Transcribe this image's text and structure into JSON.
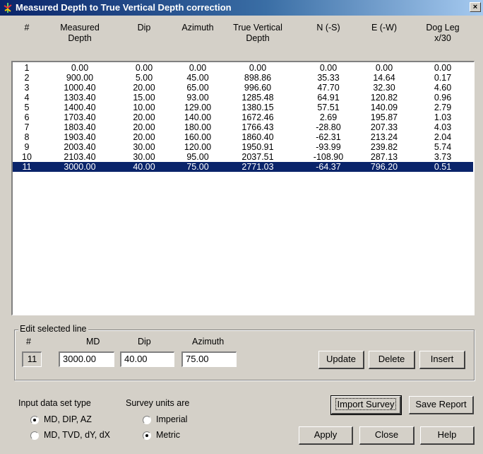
{
  "window": {
    "title": "Measured Depth to True Vertical Depth correction",
    "close_glyph": "×"
  },
  "columns": [
    {
      "key": "n",
      "label": "#"
    },
    {
      "key": "md",
      "label": "Measured\nDepth"
    },
    {
      "key": "dip",
      "label": "Dip"
    },
    {
      "key": "az",
      "label": "Azimuth"
    },
    {
      "key": "tvd",
      "label": "True Vertical\nDepth"
    },
    {
      "key": "ns",
      "label": "N (-S)"
    },
    {
      "key": "ew",
      "label": "E (-W)"
    },
    {
      "key": "dl",
      "label": "Dog Leg\nx/30"
    }
  ],
  "rows": [
    [
      "1",
      "0.00",
      "0.00",
      "0.00",
      "0.00",
      "0.00",
      "0.00",
      "0.00"
    ],
    [
      "2",
      "900.00",
      "5.00",
      "45.00",
      "898.86",
      "35.33",
      "14.64",
      "0.17"
    ],
    [
      "3",
      "1000.40",
      "20.00",
      "65.00",
      "996.60",
      "47.70",
      "32.30",
      "4.60"
    ],
    [
      "4",
      "1303.40",
      "15.00",
      "93.00",
      "1285.48",
      "64.91",
      "120.82",
      "0.96"
    ],
    [
      "5",
      "1400.40",
      "10.00",
      "129.00",
      "1380.15",
      "57.51",
      "140.09",
      "2.79"
    ],
    [
      "6",
      "1703.40",
      "20.00",
      "140.00",
      "1672.46",
      "2.69",
      "195.87",
      "1.03"
    ],
    [
      "7",
      "1803.40",
      "20.00",
      "180.00",
      "1766.43",
      "-28.80",
      "207.33",
      "4.03"
    ],
    [
      "8",
      "1903.40",
      "20.00",
      "160.00",
      "1860.40",
      "-62.31",
      "213.24",
      "2.04"
    ],
    [
      "9",
      "2003.40",
      "30.00",
      "120.00",
      "1950.91",
      "-93.99",
      "239.82",
      "5.74"
    ],
    [
      "10",
      "2103.40",
      "30.00",
      "95.00",
      "2037.51",
      "-108.90",
      "287.13",
      "3.73"
    ],
    [
      "11",
      "3000.00",
      "40.00",
      "75.00",
      "2771.03",
      "-64.37",
      "796.20",
      "0.51"
    ]
  ],
  "selected_row_index": 10,
  "edit": {
    "group_label": "Edit selected line",
    "num_label": "#",
    "md_label": "MD",
    "dip_label": "Dip",
    "az_label": "Azimuth",
    "num_value": "11",
    "md_value": "3000.00",
    "dip_value": "40.00",
    "az_value": "75.00",
    "update_label": "Update",
    "delete_label": "Delete",
    "insert_label": "Insert"
  },
  "input_type": {
    "label": "Input data set type",
    "option1": "MD, DIP, AZ",
    "option2": "MD, TVD, dY, dX",
    "selected": "MD, DIP, AZ"
  },
  "units": {
    "label": "Survey units are",
    "option1": "Imperial",
    "option2": "Metric",
    "selected": "Metric"
  },
  "buttons": {
    "import": "Import Survey",
    "save": "Save Report",
    "apply": "Apply",
    "close": "Close",
    "help": "Help"
  },
  "colors": {
    "face": "#d4d0c8",
    "selection": "#0a246a",
    "title_start": "#0a246a",
    "title_end": "#a6caf0"
  }
}
